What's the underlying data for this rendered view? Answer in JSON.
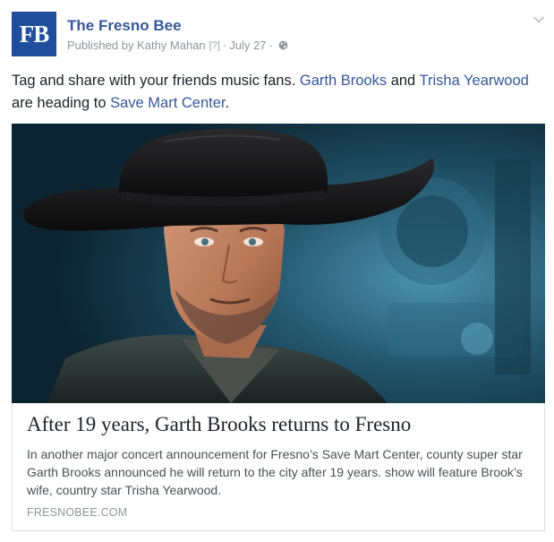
{
  "post": {
    "page_name": "The Fresno Bee",
    "logo_text": "FB",
    "published_by": "Published by Kathy Mahan",
    "help_marker": "[?]",
    "separator": "·",
    "date": "July 27",
    "audience_icon": "globe-icon",
    "menu_icon": "chevron-down-icon",
    "text": {
      "part1": "Tag and share with your friends music fans. ",
      "link1": "Garth Brooks",
      "part2": " and ",
      "link2": "Trisha Yearwood",
      "part3": " are heading to ",
      "link3": "Save Mart Center",
      "part4": "."
    }
  },
  "card": {
    "image": "photo-garth-brooks-black-cowboy-hat",
    "title": "After 19 years, Garth Brooks returns to Fresno",
    "description": "In another major concert announcement for Fresno’s Save Mart Center, county super star Garth Brooks announced he will return to the city after 19 years. show will feature Brook’s wife, country star Trisha Yearwood.",
    "domain": "FRESNOBEE.COM"
  },
  "colors": {
    "brand": "#1e4e9c",
    "link": "#365899",
    "meta": "#90949c"
  }
}
